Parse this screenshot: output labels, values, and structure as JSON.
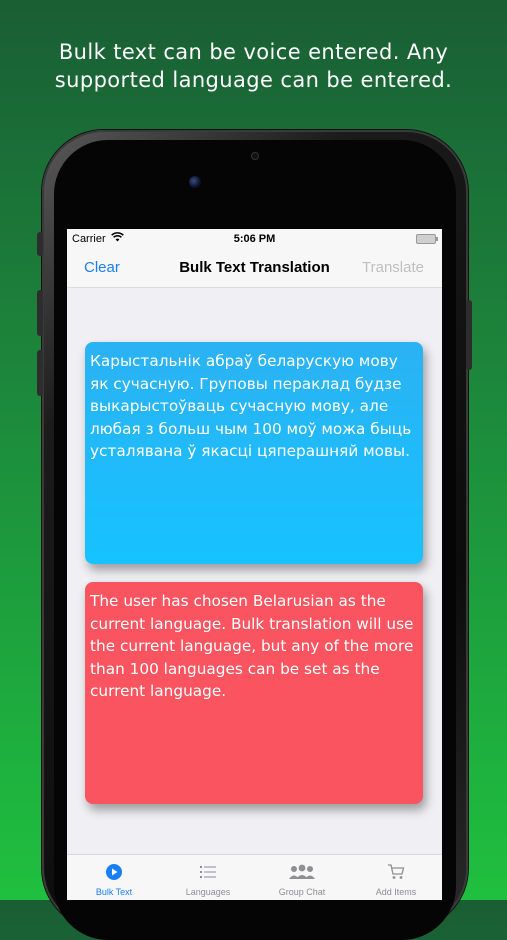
{
  "promo": {
    "line1": "Bulk text can be voice entered. Any",
    "line2": "supported language can be entered."
  },
  "status_bar": {
    "carrier": "Carrier",
    "time": "5:06 PM"
  },
  "nav": {
    "left": "Clear",
    "title": "Bulk Text Translation",
    "right": "Translate"
  },
  "cards": {
    "source_text": "Карыстальнік абраў беларускую мову як сучасную. Груповы пераклад будзе выкарыстоўваць сучасную мову, але любая з больш чым 100 моў можа быць усталявана ў якасці цяперашняй мовы.",
    "translated_text": "The user has chosen Belarusian as the current language. Bulk translation will use the current language, but any of the more than 100 languages can be set as the current language."
  },
  "tabs": [
    {
      "label": "Bulk Text",
      "icon": "play-circle-icon",
      "active": true
    },
    {
      "label": "Languages",
      "icon": "list-icon",
      "active": false
    },
    {
      "label": "Group Chat",
      "icon": "group-icon",
      "active": false
    },
    {
      "label": "Add Items",
      "icon": "cart-icon",
      "active": false
    }
  ],
  "colors": {
    "accent": "#1a7ef5",
    "source_card": "#16c2ff",
    "translated_card": "#f9545f",
    "background_top": "#1a5e34",
    "background_bottom": "#1fc03f"
  }
}
